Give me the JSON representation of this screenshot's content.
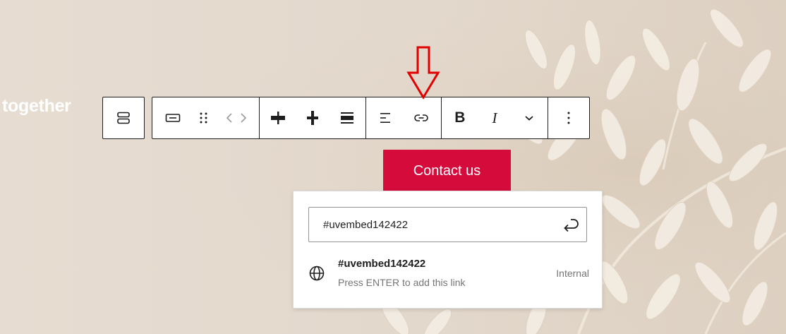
{
  "page": {
    "heading_fragment": "together"
  },
  "toolbar": {
    "parent_block": {
      "icon": "stack-icon"
    },
    "groups": [
      {
        "name": "block",
        "items": [
          {
            "icon": "button-block-icon"
          },
          {
            "icon": "drag-handle-icon"
          },
          {
            "icon": "move-arrows-icon"
          }
        ]
      },
      {
        "name": "justify",
        "items": [
          {
            "icon": "justify-center-icon"
          },
          {
            "icon": "justify-space-between-icon"
          },
          {
            "icon": "justify-stretch-icon"
          }
        ]
      },
      {
        "name": "alignment",
        "items": [
          {
            "icon": "text-align-icon"
          },
          {
            "icon": "link-icon"
          }
        ]
      },
      {
        "name": "formatting",
        "items": [
          {
            "icon": "bold-icon",
            "label": "B"
          },
          {
            "icon": "italic-icon",
            "label": "I"
          },
          {
            "icon": "chevron-down-icon"
          }
        ]
      },
      {
        "name": "more",
        "items": [
          {
            "icon": "more-options-icon"
          }
        ]
      }
    ]
  },
  "annotation": {
    "icon": "red-down-arrow-icon",
    "color": "#e10000"
  },
  "button": {
    "label": "Contact us",
    "bg_color": "#d50b3c"
  },
  "link_popover": {
    "input_value": "#uvembed142422",
    "submit_icon": "enter-icon",
    "suggestion": {
      "icon": "globe-icon",
      "title": "#uvembed142422",
      "info": "Press ENTER to add this link",
      "type": "Internal"
    }
  }
}
